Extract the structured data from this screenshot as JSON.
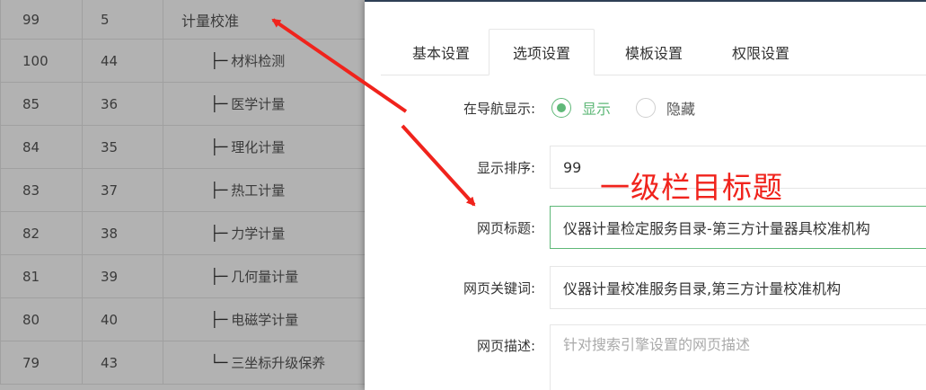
{
  "table": {
    "rows": [
      {
        "col1": "99",
        "col2": "5",
        "name": "计量校准",
        "child": false
      },
      {
        "col1": "100",
        "col2": "44",
        "name": "材料检测",
        "child": true
      },
      {
        "col1": "85",
        "col2": "36",
        "name": "医学计量",
        "child": true
      },
      {
        "col1": "84",
        "col2": "35",
        "name": "理化计量",
        "child": true
      },
      {
        "col1": "83",
        "col2": "37",
        "name": "热工计量",
        "child": true
      },
      {
        "col1": "82",
        "col2": "38",
        "name": "力学计量",
        "child": true
      },
      {
        "col1": "81",
        "col2": "39",
        "name": "几何量计量",
        "child": true
      },
      {
        "col1": "80",
        "col2": "40",
        "name": "电磁学计量",
        "child": true
      },
      {
        "col1": "79",
        "col2": "43",
        "name": "三坐标升级保养",
        "child": true,
        "last": true
      }
    ]
  },
  "panel": {
    "tabs": [
      {
        "label": "基本设置",
        "active": false
      },
      {
        "label": "选项设置",
        "active": true
      },
      {
        "label": "模板设置",
        "active": false
      },
      {
        "label": "权限设置",
        "active": false
      }
    ],
    "nav_display": {
      "label": "在导航显示:",
      "options": [
        {
          "label": "显示",
          "checked": true
        },
        {
          "label": "隐藏",
          "checked": false
        }
      ]
    },
    "sort": {
      "label": "显示排序:",
      "value": "99"
    },
    "page_title": {
      "label": "网页标题:",
      "value": "仪器计量检定服务目录-第三方计量器具校准机构"
    },
    "keywords": {
      "label": "网页关键词:",
      "value": "仪器计量校准服务目录,第三方计量校准机构"
    },
    "description": {
      "label": "网页描述:",
      "placeholder": "针对搜索引擎设置的网页描述"
    }
  },
  "annotation": {
    "text": "一级栏目标题",
    "color": "#f0231c"
  },
  "colors": {
    "accent": "#5fb878",
    "topline": "#2f3f55"
  }
}
